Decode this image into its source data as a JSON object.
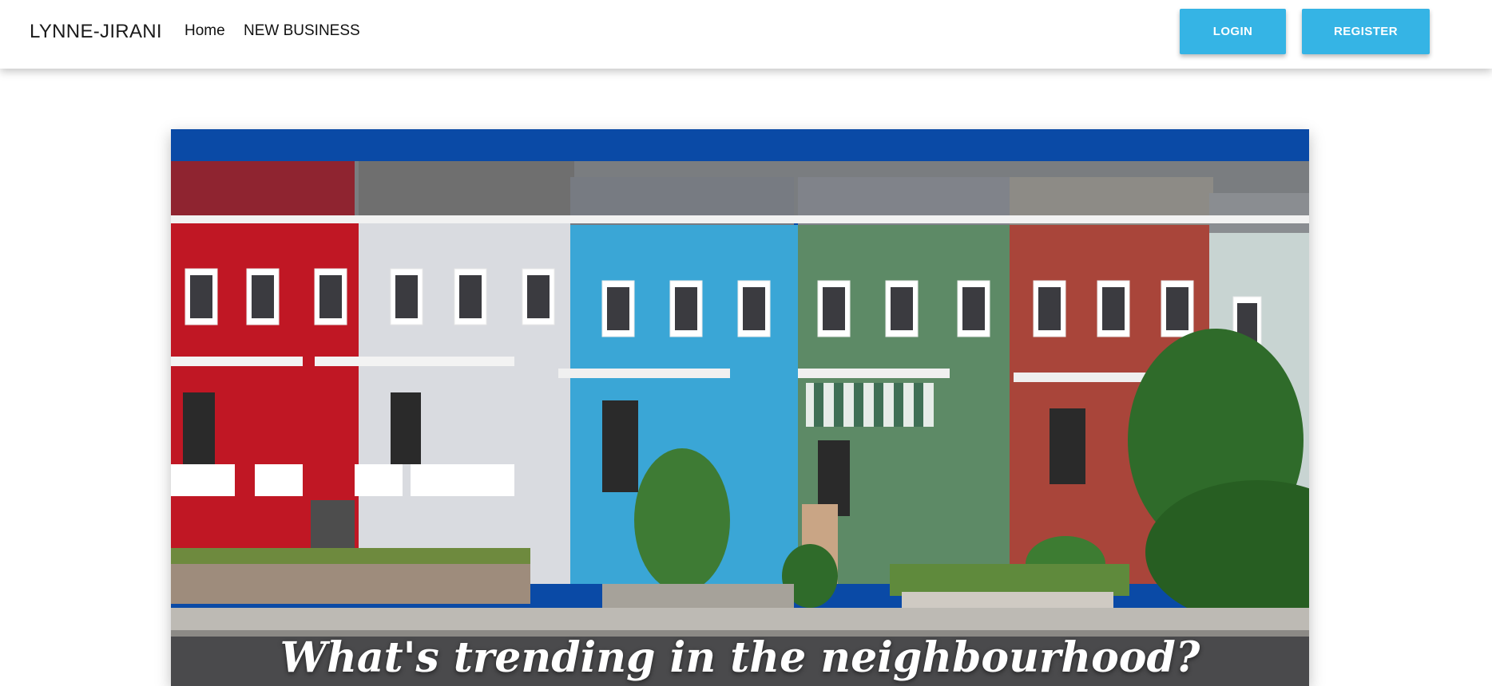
{
  "nav": {
    "brand": "LYNNE-JIRANI",
    "links": [
      {
        "label": "Home"
      },
      {
        "label": "NEW BUSINESS"
      }
    ],
    "login_label": "LOGIN",
    "register_label": "REGISTER"
  },
  "hero": {
    "title": "What's trending in the neighbourhood?",
    "image": "colorful-rowhouses-street-photo"
  },
  "colors": {
    "accent": "#35b4e5",
    "sky": "#0a4aa6"
  }
}
